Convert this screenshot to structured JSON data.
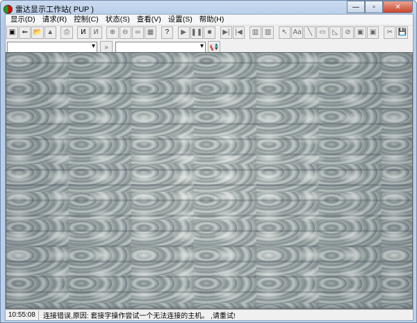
{
  "window": {
    "title": "雷达显示工作站( PUP )",
    "minimize": "—",
    "maximize": "▫",
    "close": "✕"
  },
  "menu": [
    "显示(D)",
    "请求(R)",
    "控制(C)",
    "状态(S)",
    "查看(V)",
    "设置(S)",
    "帮助(H)"
  ],
  "toolbar": {
    "groups": [
      [
        {
          "icon": "display-icon",
          "g": "▣",
          "on": true
        },
        {
          "icon": "import-icon",
          "g": "⇐",
          "on": true
        },
        {
          "icon": "open-folder-icon",
          "g": "📂",
          "on": true
        },
        {
          "icon": "alarm-icon",
          "g": "▲"
        }
      ],
      [
        {
          "icon": "print-icon",
          "g": "⎙"
        }
      ],
      [
        {
          "icon": "line-chart-icon",
          "g": "Ͷ",
          "on": true
        },
        {
          "icon": "line-chart-disabled-icon",
          "g": "Ͷ"
        }
      ],
      [
        {
          "icon": "zoom-in-icon",
          "g": "⊕"
        },
        {
          "icon": "zoom-out-icon",
          "g": "⊖"
        },
        {
          "icon": "link-icon",
          "g": "∞"
        },
        {
          "icon": "grid-icon",
          "g": "▦"
        }
      ],
      [
        {
          "icon": "help-icon",
          "g": "?",
          "on": true
        }
      ],
      [
        {
          "icon": "play-icon",
          "g": "▶"
        },
        {
          "icon": "pause-icon",
          "g": "❚❚"
        },
        {
          "icon": "stop-icon",
          "g": "■"
        }
      ],
      [
        {
          "icon": "step-forward-icon",
          "g": "▶|"
        },
        {
          "icon": "step-back-icon",
          "g": "|◀"
        }
      ],
      [
        {
          "icon": "table-icon",
          "g": "▥"
        },
        {
          "icon": "table-alt-icon",
          "g": "▥"
        }
      ],
      [
        {
          "icon": "pointer-icon",
          "g": "↖"
        },
        {
          "icon": "text-icon",
          "g": "Aa"
        },
        {
          "icon": "line-icon",
          "g": "╲"
        },
        {
          "icon": "rectangle-icon",
          "g": "▭"
        },
        {
          "icon": "polygon-icon",
          "g": "◺"
        },
        {
          "icon": "circle-icon",
          "g": "⊘"
        },
        {
          "icon": "fill-icon",
          "g": "▣"
        },
        {
          "icon": "fill-alt-icon",
          "g": "▣"
        }
      ],
      [
        {
          "icon": "cut-icon",
          "g": "✂"
        },
        {
          "icon": "save-icon",
          "g": "💾"
        }
      ]
    ]
  },
  "row2": {
    "combo1": "",
    "forward": "»",
    "combo2": "",
    "send_icon": "horn-icon",
    "send": "📢"
  },
  "status": {
    "time": "10:55:08",
    "message": "连接错误,原因: 套接字操作尝试一个无法连接的主机。 ,请重试!"
  }
}
